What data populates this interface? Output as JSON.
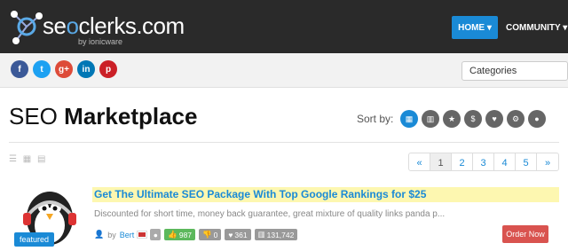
{
  "header": {
    "logo": {
      "prefix": "se",
      "middle": "o",
      "suffix": "clerks.com",
      "subtitle": "by ionicware"
    },
    "nav": {
      "home": "HOME ▾",
      "community": "COMMUNITY ▾"
    }
  },
  "social": [
    {
      "name": "facebook-icon",
      "glyph": "f",
      "color": "#3b5998"
    },
    {
      "name": "twitter-icon",
      "glyph": "t",
      "color": "#1da1f2"
    },
    {
      "name": "googleplus-icon",
      "glyph": "g+",
      "color": "#dd4b39"
    },
    {
      "name": "linkedin-icon",
      "glyph": "in",
      "color": "#0077b5"
    },
    {
      "name": "pinterest-icon",
      "glyph": "p",
      "color": "#cb2027"
    }
  ],
  "categories": {
    "selected": "Categories"
  },
  "page": {
    "title_light": "SEO",
    "title_bold": "Marketplace"
  },
  "sort": {
    "label": "Sort by:",
    "options": [
      {
        "name": "sort-date-icon",
        "glyph": "▦"
      },
      {
        "name": "sort-chart-icon",
        "glyph": "▥"
      },
      {
        "name": "sort-rating-icon",
        "glyph": "★"
      },
      {
        "name": "sort-price-icon",
        "glyph": "$"
      },
      {
        "name": "sort-heart-icon",
        "glyph": "♥"
      },
      {
        "name": "sort-settings-icon",
        "glyph": "⚙"
      },
      {
        "name": "sort-circle-icon",
        "glyph": "●"
      }
    ]
  },
  "pagination": [
    "«",
    "1",
    "2",
    "3",
    "4",
    "5",
    "»"
  ],
  "listing": {
    "badge": "featured",
    "title": "Get The Ultimate SEO Package With Top Google Rankings for $25",
    "description": "Discounted for short time, money back guarantee, great mixture of quality links panda p...",
    "by": "by",
    "seller": "Bert",
    "thumbs_up": "987",
    "thumbs_down": "0",
    "likes": "361",
    "views": "131,742",
    "order_button": "Order Now"
  }
}
